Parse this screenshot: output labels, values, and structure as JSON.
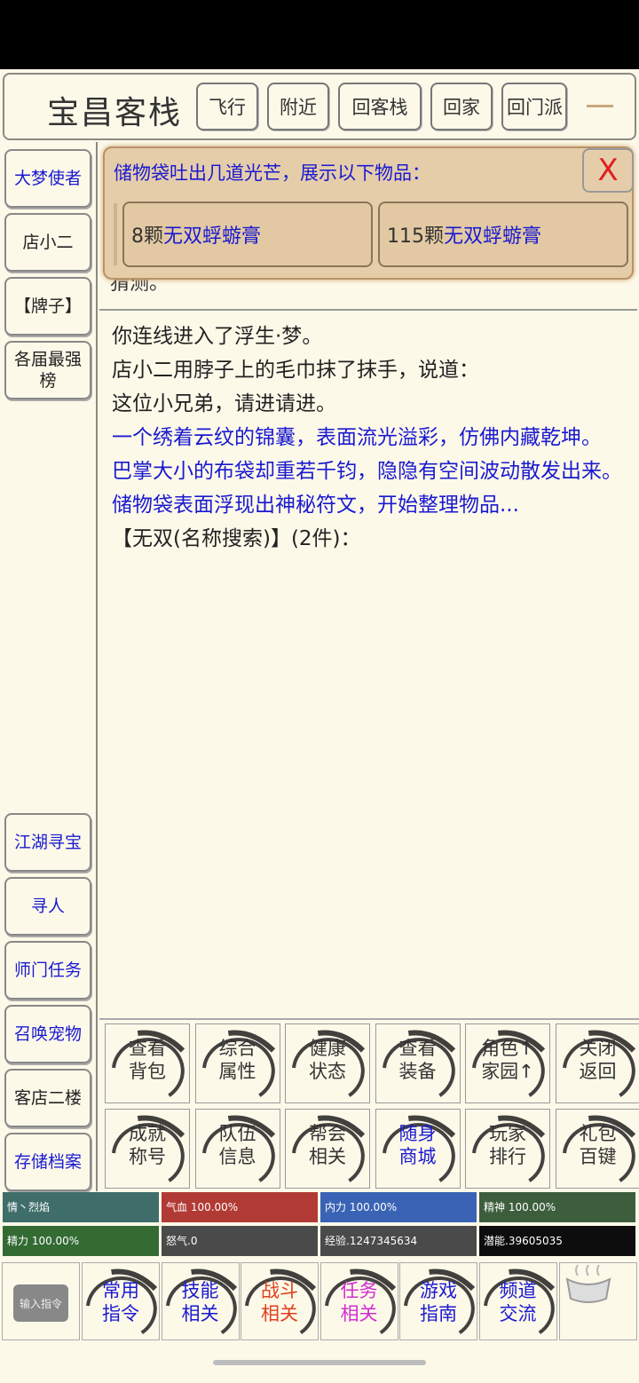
{
  "header": {
    "title": "宝昌客栈",
    "buttons": [
      "飞行",
      "附近",
      "回客栈",
      "回家",
      "回门派"
    ]
  },
  "left_menu": {
    "top": [
      "大梦使者",
      "店小二",
      "【牌子】",
      "各届最强榜"
    ],
    "bottom": [
      "江湖寻宝",
      "寻人",
      "师门任务",
      "召唤宠物",
      "客店二楼",
      "存储档案"
    ]
  },
  "popup": {
    "title": "储物袋吐出几道光芒，展示以下物品：",
    "close": "X",
    "items": [
      {
        "qty": "8颗",
        "name": "无双蜉蝣膏"
      },
      {
        "qty": "115颗",
        "name": "无双蜉蝣膏"
      }
    ]
  },
  "cut_text": "猜测。",
  "log": [
    {
      "text": "你连线进入了浮生·梦。",
      "color": "black"
    },
    {
      "text": "店小二用脖子上的毛巾抹了抹手，说道：",
      "color": "black"
    },
    {
      "text": "这位小兄弟，请进请进。",
      "color": "black"
    },
    {
      "text": "一个绣着云纹的锦囊，表面流光溢彩，仿佛内藏乾坤。",
      "color": "blue"
    },
    {
      "text": "巴掌大小的布袋却重若千钧，隐隐有空间波动散发出来。",
      "color": "blue"
    },
    {
      "text": "储物袋表面浮现出神秘符文，开始整理物品...",
      "color": "blue"
    },
    {
      "text": "【无双(名称搜索)】(2件)：",
      "color": "black"
    }
  ],
  "grid": [
    {
      "l1": "查看",
      "l2": "背包",
      "color": "#333333"
    },
    {
      "l1": "综合",
      "l2": "属性",
      "color": "#333333"
    },
    {
      "l1": "健康",
      "l2": "状态",
      "color": "#333333"
    },
    {
      "l1": "查看",
      "l2": "装备",
      "color": "#333333"
    },
    {
      "l1": "角色↑",
      "l2": "家园↑",
      "color": "#333333"
    },
    {
      "l1": "关闭",
      "l2": "返回",
      "color": "#333333"
    },
    {
      "l1": "成就",
      "l2": "称号",
      "color": "#333333"
    },
    {
      "l1": "队伍",
      "l2": "信息",
      "color": "#333333"
    },
    {
      "l1": "帮会",
      "l2": "相关",
      "color": "#333333"
    },
    {
      "l1": "随身",
      "l2": "商城",
      "color": "#1a1ad0"
    },
    {
      "l1": "玩家",
      "l2": "排行",
      "color": "#333333"
    },
    {
      "l1": "礼包",
      "l2": "百键",
      "color": "#333333"
    }
  ],
  "stats": [
    {
      "label": "情丶烈焰",
      "bg": "#3f6d6a"
    },
    {
      "label": "气血 100.00%",
      "bg": "#b23a34"
    },
    {
      "label": "内力 100.00%",
      "bg": "#3a63b5"
    },
    {
      "label": "精神 100.00%",
      "bg": "#3d5e3d"
    },
    {
      "label": "精力 100.00%",
      "bg": "#336b33"
    },
    {
      "label": "怒气.0",
      "bg": "#4a4a4a"
    },
    {
      "label": "经验.1247345634",
      "bg": "#4a4a4a"
    },
    {
      "label": "潜能.39605035",
      "bg": "#0d0d0d"
    }
  ],
  "bottom_nav": {
    "input_label": "输入指令",
    "items": [
      {
        "l1": "常用",
        "l2": "指令",
        "color": "#1a1ad0"
      },
      {
        "l1": "技能",
        "l2": "相关",
        "color": "#1a1ad0"
      },
      {
        "l1": "战斗",
        "l2": "相关",
        "color": "#e0401e"
      },
      {
        "l1": "任务",
        "l2": "相关",
        "color": "#d02ed0"
      },
      {
        "l1": "游戏",
        "l2": "指南",
        "color": "#1a1ad0"
      },
      {
        "l1": "频道",
        "l2": "交流",
        "color": "#1a1ad0"
      }
    ]
  }
}
